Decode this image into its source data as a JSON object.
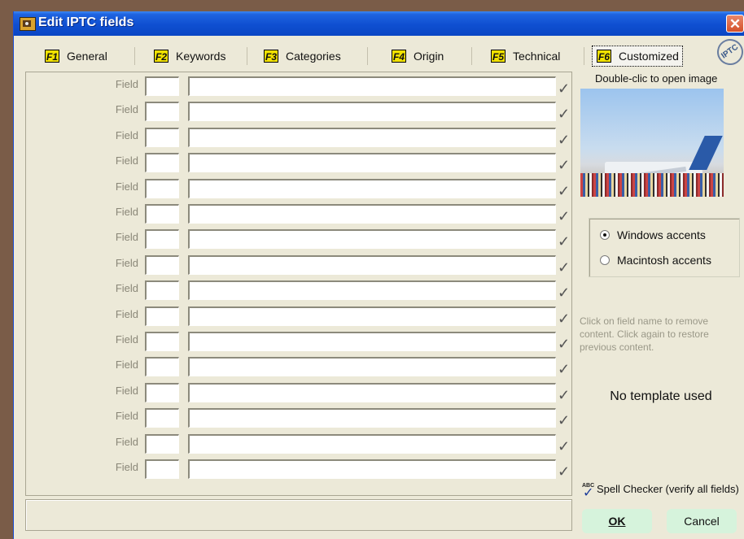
{
  "window": {
    "title": "Edit IPTC fields",
    "close_glyph": "✕"
  },
  "tabs": [
    {
      "key": "F1",
      "label": "General"
    },
    {
      "key": "F2",
      "label": "Keywords"
    },
    {
      "key": "F3",
      "label": "Categories"
    },
    {
      "key": "F4",
      "label": "Origin"
    },
    {
      "key": "F5",
      "label": "Technical"
    },
    {
      "key": "F6",
      "label": "Customized",
      "active": true
    }
  ],
  "logo_text": "IPTC",
  "fields": {
    "label": "Field",
    "check_glyph": "✓",
    "rows": [
      {
        "code": "",
        "value": ""
      },
      {
        "code": "",
        "value": ""
      },
      {
        "code": "",
        "value": ""
      },
      {
        "code": "",
        "value": ""
      },
      {
        "code": "",
        "value": ""
      },
      {
        "code": "",
        "value": ""
      },
      {
        "code": "",
        "value": ""
      },
      {
        "code": "",
        "value": ""
      },
      {
        "code": "",
        "value": ""
      },
      {
        "code": "",
        "value": ""
      },
      {
        "code": "",
        "value": ""
      },
      {
        "code": "",
        "value": ""
      },
      {
        "code": "",
        "value": ""
      },
      {
        "code": "",
        "value": ""
      },
      {
        "code": "",
        "value": ""
      },
      {
        "code": "",
        "value": ""
      }
    ]
  },
  "preview": {
    "caption": "Double-clic to open image"
  },
  "accents": {
    "windows": "Windows accents",
    "macintosh": "Macintosh accents",
    "selected": "windows"
  },
  "help_text": "Click on field name to remove content. Click again to restore previous content.",
  "template_status": "No template used",
  "spell_checker": {
    "icon_text": "ABC",
    "label": "Spell Checker (verify all fields)"
  },
  "buttons": {
    "ok": "OK",
    "cancel": "Cancel"
  },
  "status_text": ""
}
